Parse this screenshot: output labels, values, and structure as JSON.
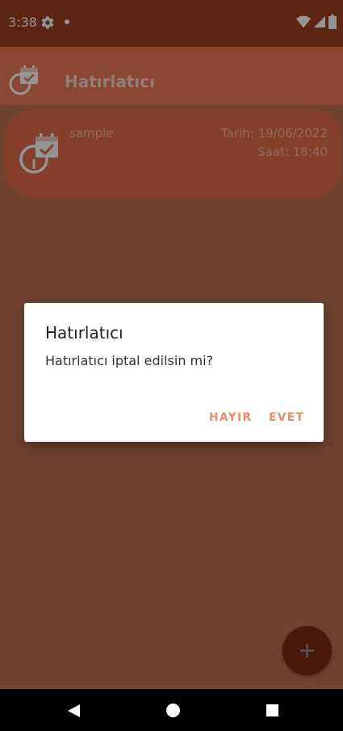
{
  "status_bar": {
    "time": "3:38",
    "icons": [
      "gear-icon",
      "notification-dot-icon",
      "wifi-icon",
      "signal-icon",
      "battery-icon"
    ]
  },
  "app_bar": {
    "title": "Hatırlatıcı",
    "icon": "calendar-alarm-icon"
  },
  "reminders": [
    {
      "name": "sample",
      "date": "Tarih: 19/06/2022",
      "time": "Saat: 18:40",
      "icon": "calendar-alarm-icon"
    }
  ],
  "dialog": {
    "title": "Hatırlatıcı",
    "message": "Hatırlatıcı iptal edilsin mi?",
    "negative_label": "HAYIR",
    "positive_label": "EVET"
  },
  "fab": {
    "icon": "plus-icon"
  },
  "nav_bar": {
    "icons": [
      "back-icon",
      "home-icon",
      "recents-icon"
    ]
  },
  "colors": {
    "primary_dark": "#A04022",
    "primary": "#EE7B58",
    "accent": "#D94A20",
    "dialog_button": "#F08A68"
  }
}
